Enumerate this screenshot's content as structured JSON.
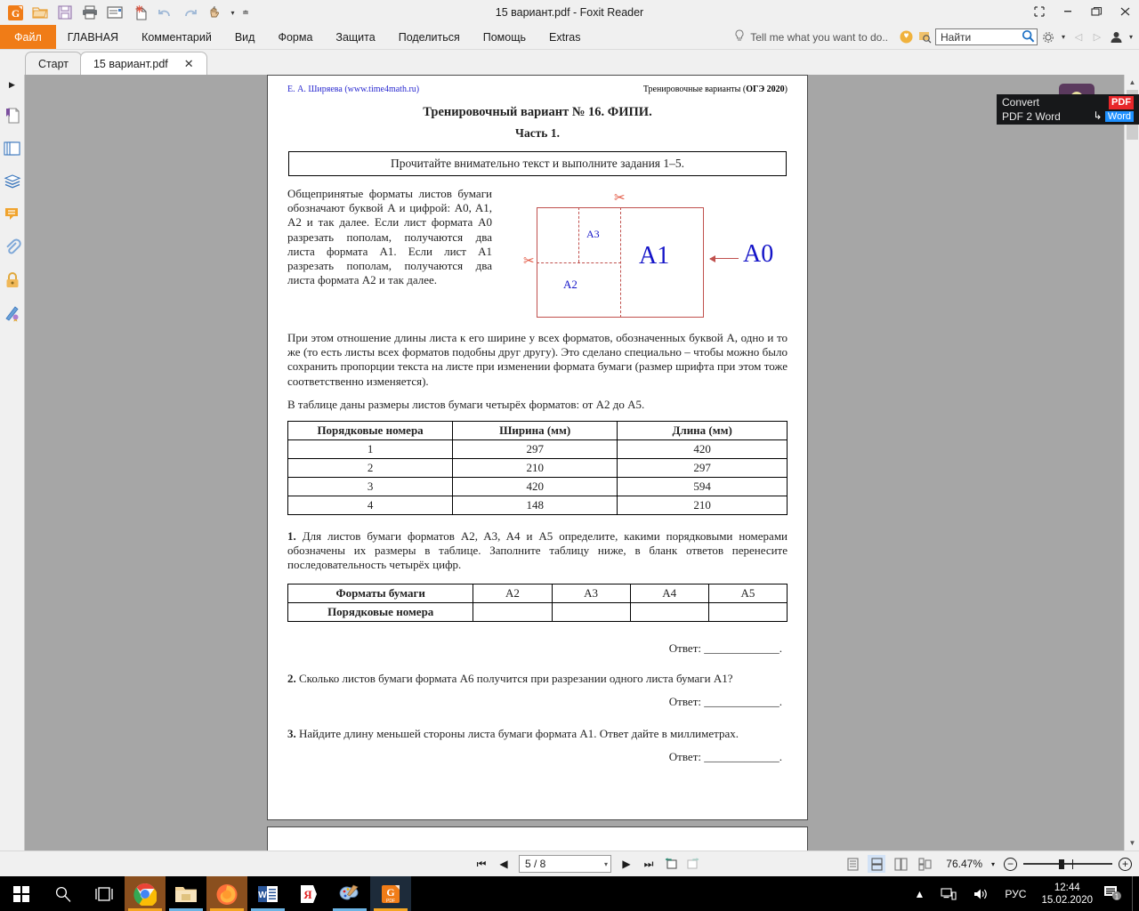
{
  "window": {
    "title": "15 вариант.pdf - Foxit Reader",
    "buttons": {
      "restore": "❐",
      "minimize": "—",
      "maximize": "❐",
      "close": "✕"
    }
  },
  "quick_access": [
    {
      "name": "foxit-logo-icon",
      "glyph": "G"
    },
    {
      "name": "open-file-icon",
      "glyph": "📂"
    },
    {
      "name": "save-icon",
      "glyph": "💾"
    },
    {
      "name": "print-icon",
      "glyph": "🖨"
    },
    {
      "name": "email-icon",
      "glyph": "✉"
    },
    {
      "name": "new-from-file-icon",
      "glyph": "✳"
    },
    {
      "name": "undo-icon",
      "glyph": "↺"
    },
    {
      "name": "redo-icon",
      "glyph": "↻"
    },
    {
      "name": "hand-tool-icon",
      "glyph": "☚"
    },
    {
      "name": "dropdown-arrow-icon",
      "glyph": "▾"
    },
    {
      "name": "customize-toolbar-icon",
      "glyph": "≐"
    }
  ],
  "menu": {
    "file_label": "Файл",
    "items": [
      "ГЛАВНАЯ",
      "Комментарий",
      "Вид",
      "Форма",
      "Защита",
      "Поделиться",
      "Помощь",
      "Extras"
    ],
    "tell_me": "Tell me what you want to do..",
    "search_placeholder": "Найти"
  },
  "tabs": [
    {
      "label": "Старт",
      "active": false,
      "closable": false
    },
    {
      "label": "15 вариант.pdf",
      "active": true,
      "closable": true,
      "close_glyph": "✕"
    }
  ],
  "convert_ad": {
    "line1": "Convert",
    "line2": "PDF 2 Word",
    "badge_pdf": "PDF",
    "badge_word": "Word",
    "arrow": "↳"
  },
  "nav_panel": {
    "toggle_glyph": "▶",
    "icons": [
      "bookmarks-icon",
      "page-thumbnails-icon",
      "layers-icon",
      "comments-icon",
      "attachments-icon",
      "security-icon",
      "signatures-icon"
    ]
  },
  "right_panel": {
    "bulb_icon": "bulb-icon"
  },
  "document": {
    "header_left": "Е. А. Ширяева (www.time4math.ru)",
    "header_right_plain": "Тренировочные варианты (",
    "header_right_bold": "ОГЭ 2020",
    "header_right_tail": ")",
    "title": "Тренировочный вариант № 16. ФИПИ.",
    "subtitle": "Часть 1.",
    "instruction": "Прочитайте внимательно текст и выполните задания 1–5.",
    "intro_text": "Общепринятые форматы листов бумаги обозначают буквой A и цифрой: A0, A1, A2 и так далее. Если лист формата A0 разрезать пополам, получаются два листа формата A1. Если лист A1 разрезать пополам, получаются два листа формата A2 и так далее.",
    "para2": "При этом отношение длины листа к его ширине у всех форматов, обозначенных буквой A, одно и то же (то есть листы всех форматов подобны друг другу). Это сделано специально – чтобы можно было сохранить пропорции текста на листе при изменении формата бумаги (размер шрифта при этом тоже соответственно изменяется).",
    "para3": "В таблице даны размеры листов бумаги четырёх форматов: от A2 до A5.",
    "figure": {
      "label_a0": "A0",
      "label_a1": "A1",
      "label_a2": "A2",
      "label_a3": "A3",
      "scissors_glyph": "✂",
      "rect_color": "#c0504d",
      "label_color": "#1414c8"
    },
    "table_sizes": {
      "headers": [
        "Порядковые номера",
        "Ширина (мм)",
        "Длина (мм)"
      ],
      "rows": [
        [
          "1",
          "297",
          "420"
        ],
        [
          "2",
          "210",
          "297"
        ],
        [
          "3",
          "420",
          "594"
        ],
        [
          "4",
          "148",
          "210"
        ]
      ]
    },
    "q1": {
      "num": "1.",
      "text": " Для листов бумаги форматов A2, A3, A4 и A5 определите, какими порядковыми номерами обозначены их размеры в таблице. Заполните таблицу ниже, в бланк ответов перенесите последовательность четырёх цифр."
    },
    "table_answer": {
      "row1_label": "Форматы бумаги",
      "row1_values": [
        "A2",
        "A3",
        "A4",
        "A5"
      ],
      "row2_label": "Порядковые номера",
      "row2_values": [
        "",
        "",
        "",
        ""
      ]
    },
    "answer_label": "Ответ: ",
    "answer_blank": "_____________.",
    "q2": {
      "num": "2.",
      "text": " Сколько листов бумаги формата A6 получится при разрезании одного листа бумаги A1?"
    },
    "q3": {
      "num": "3.",
      "text": " Найдите длину меньшей стороны листа бумаги формата A1. Ответ дайте в миллиметрах."
    }
  },
  "statusbar": {
    "first_page_icon": "⏮",
    "prev_page_icon": "◀",
    "page_value": "5 / 8",
    "page_caret": "▾",
    "next_page_icon": "▶",
    "last_page_icon": "⏭",
    "prev_view_icon": "previous-view-icon",
    "next_view_icon": "next-view-icon",
    "view_single_icon": "single-page-view-icon",
    "view_continuous_icon": "continuous-view-icon",
    "view_facing_icon": "facing-page-view-icon",
    "view_facing_cover_icon": "facing-cover-view-icon",
    "zoom_value": "76.47%",
    "zoom_caret": "▾",
    "zoom_out": "−",
    "zoom_in": "+"
  },
  "taskbar": {
    "start_icon": "windows-start-icon",
    "search_icon": "search-icon",
    "taskview_icon": "task-view-icon",
    "apps": [
      {
        "name": "chrome-taskbar-icon",
        "running": true
      },
      {
        "name": "file-explorer-taskbar-icon",
        "running": true
      },
      {
        "name": "firefox-taskbar-icon",
        "running": true
      },
      {
        "name": "word-taskbar-icon",
        "running": true
      },
      {
        "name": "yandex-browser-taskbar-icon",
        "running": true
      },
      {
        "name": "paint-taskbar-icon",
        "running": true
      },
      {
        "name": "foxit-reader-taskbar-icon",
        "running": true,
        "active": true
      }
    ],
    "tray": {
      "expand_icon": "▲",
      "network_icon": "network-icon",
      "volume_icon": "volume-icon",
      "language": "РУС",
      "time": "12:44",
      "date": "15.02.2020",
      "notifications_icon": "notifications-icon",
      "notification_count": "1"
    }
  }
}
